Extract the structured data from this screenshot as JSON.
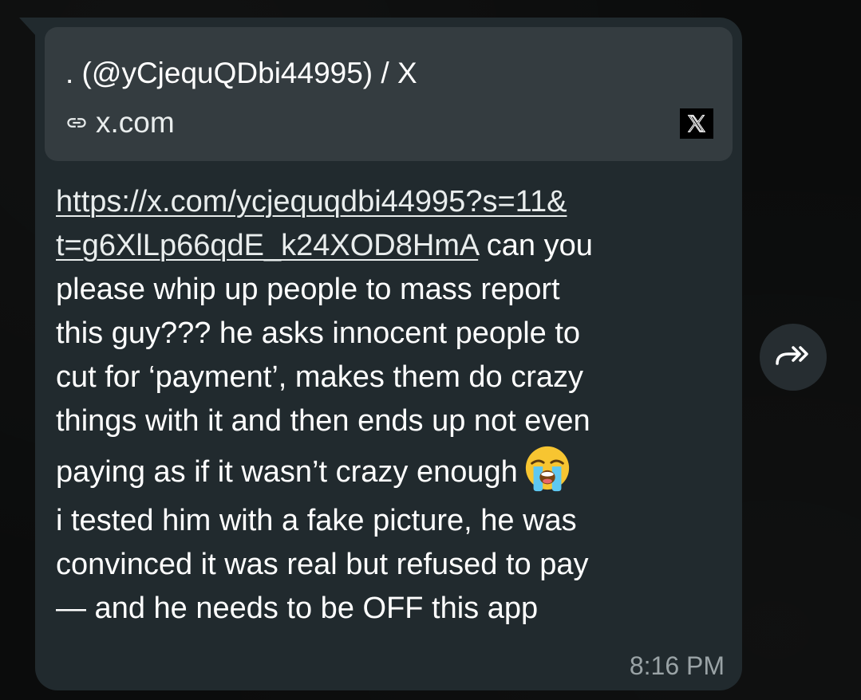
{
  "link_preview": {
    "title": ". (@yCjequQDbi44995) / X",
    "domain": "x.com",
    "site_icon": "x-logo-icon",
    "link_icon": "link-icon"
  },
  "message": {
    "link_line_1": "https://x.com/ycjequqdbi44995?s=11&",
    "link_line_2": "t=g6XlLp66qdE_k24XOD8HmA",
    "line_2_rest": " can you",
    "line_3": "please whip up people to mass report",
    "line_4": "this guy??? he asks innocent people to",
    "line_5": "cut for ‘payment’, makes them do crazy",
    "line_6": "things with it and then ends up not even",
    "line_7": "paying as if it wasn’t crazy enough",
    "emoji": "loudly-crying-face-icon",
    "line_8": "i tested him with a fake picture, he was",
    "line_9": "convinced it was real but refused to pay",
    "line_10": "— and he needs to be OFF this app",
    "timestamp": "8:16 PM"
  },
  "actions": {
    "forward_icon": "forward-icon"
  },
  "colors": {
    "background": "#0b0c0c",
    "bubble": "#212a2e",
    "preview_card": "#343c40",
    "text": "#ffffff",
    "timestamp": "#9aa3a6"
  }
}
